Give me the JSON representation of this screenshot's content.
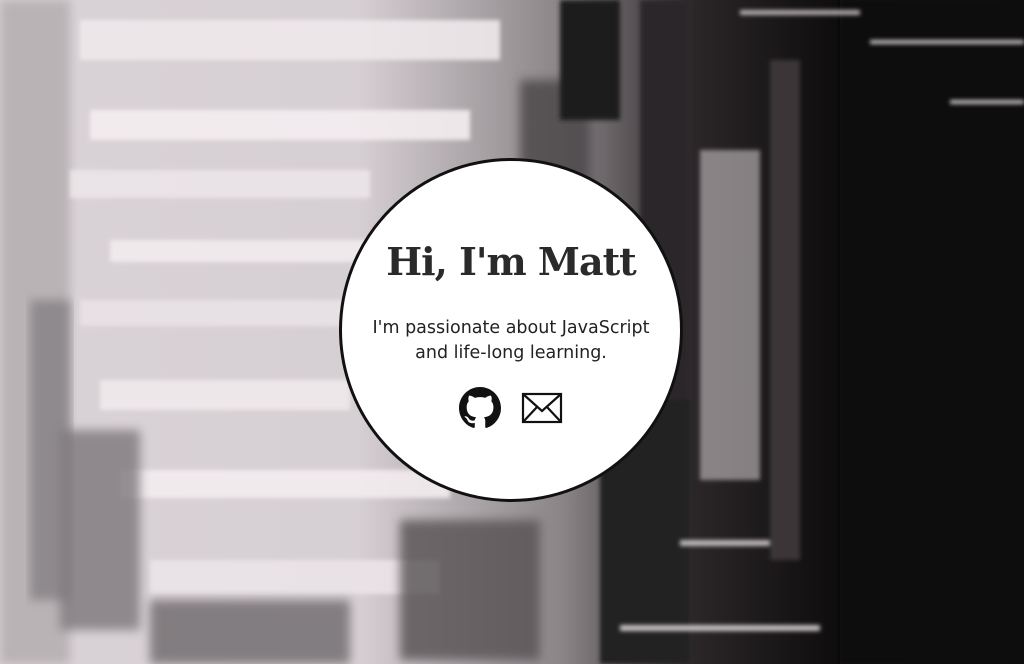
{
  "hero": {
    "heading": "Hi, I'm Matt",
    "tagline_line1": "I'm passionate about JavaScript",
    "tagline_line2": "and life-long learning."
  },
  "links": [
    {
      "icon": "github-icon",
      "label": "GitHub"
    },
    {
      "icon": "envelope-icon",
      "label": "Email"
    }
  ],
  "colors": {
    "card_background": "#ffffff",
    "card_border": "#111111",
    "text": "#2a2a2a"
  }
}
